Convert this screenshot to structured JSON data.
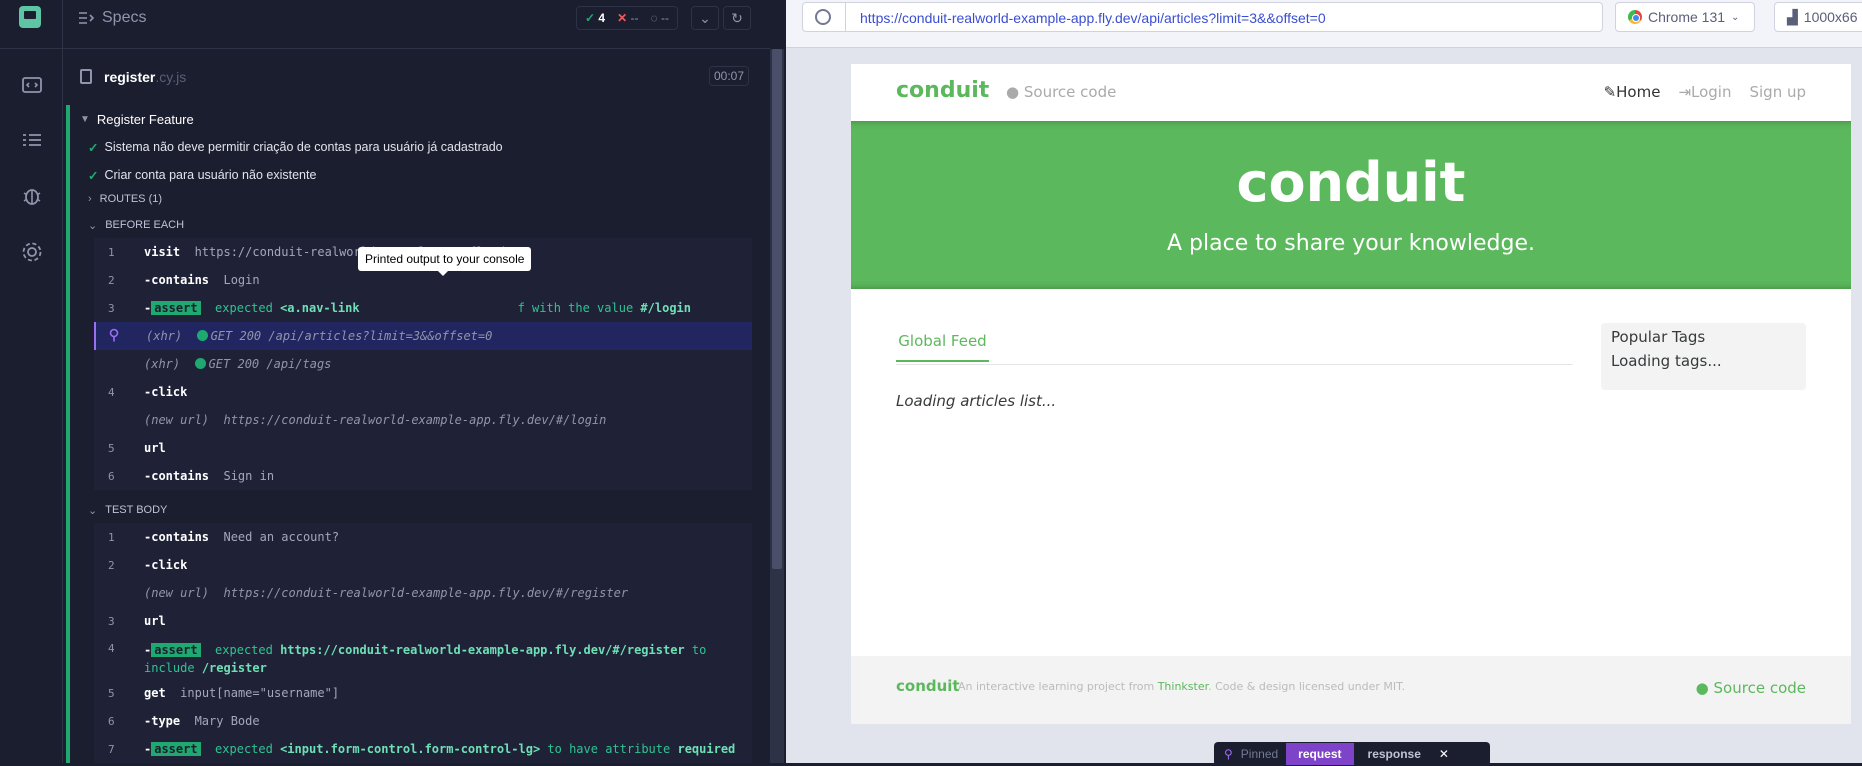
{
  "reporter": {
    "header": {
      "title": "Specs",
      "passed": "4",
      "failed": "--",
      "pending": "--"
    },
    "spec": {
      "name": "register",
      "ext": ".cy.js",
      "duration": "00:07"
    },
    "suite": "Register Feature",
    "tests": [
      "Sistema não deve permitir criação de contas para usuário já cadastrado",
      "Criar conta para usuário não existente"
    ],
    "routes": "ROUTES (1)",
    "before_each": "BEFORE EACH",
    "test_body": "TEST BODY",
    "tooltip": "Printed output to your console",
    "be": [
      {
        "n": "1",
        "name": "visit",
        "arg": "https://conduit-realworld-example-app.fly.dev/"
      },
      {
        "n": "2",
        "name": "-contains",
        "arg": "Login"
      },
      {
        "n": "3",
        "name": "assert",
        "expected": "expected",
        "el": "<a.nav-link",
        "tail": "f",
        "with": "with the value",
        "val": "#/login"
      },
      {
        "n": "",
        "xhr": "(xhr)",
        "req": "GET 200 /api/articles?limit=3&&offset=0"
      },
      {
        "n": "",
        "xhr": "(xhr)",
        "req": "GET 200 /api/tags"
      },
      {
        "n": "4",
        "name": "-click"
      },
      {
        "n": "",
        "newurl": "(new url)",
        "arg": "https://conduit-realworld-example-app.fly.dev/#/login"
      },
      {
        "n": "5",
        "name": "url"
      },
      {
        "n": "6",
        "name": "-contains",
        "arg": "Sign in"
      }
    ],
    "tb": [
      {
        "n": "1",
        "name": "-contains",
        "arg": "Need an account?"
      },
      {
        "n": "2",
        "name": "-click"
      },
      {
        "n": "",
        "newurl": "(new url)",
        "arg": "https://conduit-realworld-example-app.fly.dev/#/register"
      },
      {
        "n": "3",
        "name": "url"
      },
      {
        "n": "4",
        "name": "assert",
        "expected": "expected",
        "val": "https://conduit-realworld-example-app.fly.dev/#/register",
        "to": "to",
        "line2a": "include",
        "line2b": "/register"
      },
      {
        "n": "5",
        "name": "get",
        "arg": "input[name=\"username\"]"
      },
      {
        "n": "6",
        "name": "-type",
        "arg": "Mary Bode"
      },
      {
        "n": "7",
        "name": "assert",
        "expected": "expected",
        "el": "<input.form-control.form-control-lg>",
        "to": "to have attribute",
        "val": "required"
      }
    ]
  },
  "aut": {
    "url": "https://conduit-realworld-example-app.fly.dev/api/articles?limit=3&&offset=0",
    "browser": "Chrome 131",
    "viewport": "1000x66",
    "app": {
      "brand": "conduit",
      "source": "Source code",
      "nav": [
        "Home",
        "Login",
        "Sign up"
      ],
      "banner_title": "conduit",
      "banner_sub": "A place to share your knowledge.",
      "feed_tab": "Global Feed",
      "loading": "Loading articles list...",
      "tags_title": "Popular Tags",
      "tags_loading": "Loading tags...",
      "footer_brand": "conduit",
      "footer_text": "An interactive learning project from",
      "footer_link": "Thinkster",
      "footer_text2": ". Code & design licensed under MIT.",
      "footer_source": "Source code"
    },
    "pinned": {
      "label": "Pinned",
      "request": "request",
      "response": "response"
    }
  },
  "colors": {
    "pass": "#1fa971",
    "fail": "#f15a5a",
    "brand": "#5cb85c",
    "bg": "#1b1e2e"
  }
}
